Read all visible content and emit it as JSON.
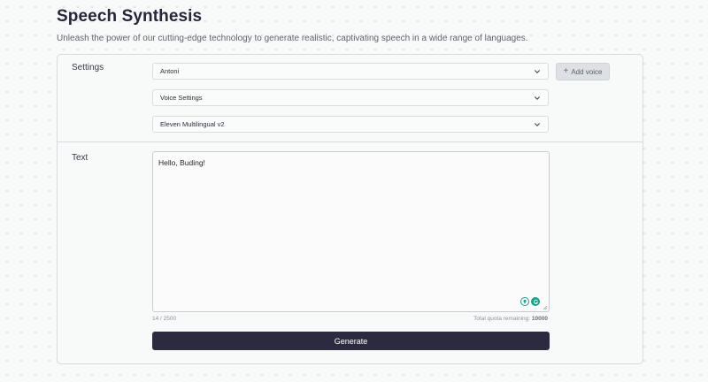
{
  "header": {
    "title": "Speech Synthesis",
    "subtitle": "Unleash the power of our cutting-edge technology to generate realistic, captivating speech in a wide range of languages."
  },
  "settings": {
    "label": "Settings",
    "voice_select": "Antoni",
    "voice_settings_select": "Voice Settings",
    "model_select": "Eleven Multilingual v2",
    "add_voice_label": "Add voice"
  },
  "text_section": {
    "label": "Text",
    "value": "Hello, Buding!",
    "char_count": "14 / 2500",
    "quota_label": "Total quota remaining:",
    "quota_value": "10000"
  },
  "actions": {
    "generate_label": "Generate"
  },
  "colors": {
    "primary_button": "#2c2a40",
    "accent_green": "#13a38a"
  },
  "icons": [
    "chevron-down-icon",
    "plus-icon",
    "lightbulb-icon",
    "grammarly-icon",
    "resize-handle-icon"
  ]
}
